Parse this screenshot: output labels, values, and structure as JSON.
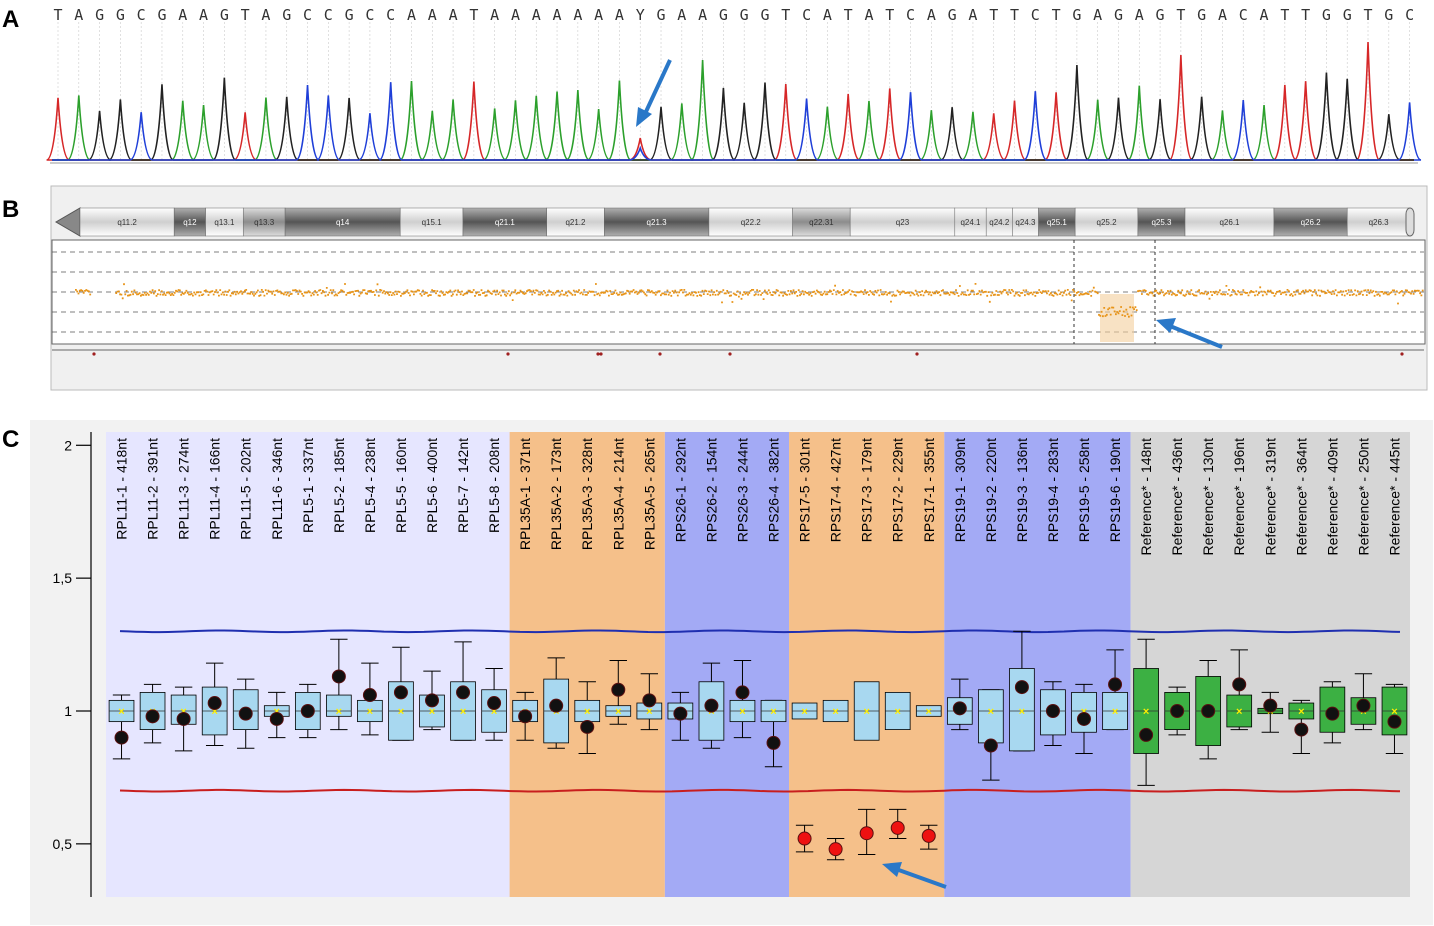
{
  "panels": {
    "a": "A",
    "b": "B",
    "c": "C"
  },
  "sequence": {
    "bases": "TAGGCGAAGTAGCCGCCAAATAAAAAAAYGAAGGGTCATATCAGATTCTGAGAGTGACATTGGTGC",
    "colors": {
      "A": "#2ca02c",
      "T": "#d62728",
      "G": "#222222",
      "C": "#1f3fd8"
    },
    "highlighted_index": 28
  },
  "karyotype": {
    "bands": [
      {
        "label": "q11.2",
        "stain": "light"
      },
      {
        "label": "q12",
        "stain": "dark"
      },
      {
        "label": "q13.1",
        "stain": "light"
      },
      {
        "label": "q13.3",
        "stain": "mid"
      },
      {
        "label": "q14",
        "stain": "dark"
      },
      {
        "label": "q15.1",
        "stain": "light"
      },
      {
        "label": "q21.1",
        "stain": "dark"
      },
      {
        "label": "q21.2",
        "stain": "light"
      },
      {
        "label": "q21.3",
        "stain": "dark"
      },
      {
        "label": "q22.2",
        "stain": "light"
      },
      {
        "label": "q22.31",
        "stain": "mid"
      },
      {
        "label": "q23",
        "stain": "light"
      },
      {
        "label": "q24.1",
        "stain": "light"
      },
      {
        "label": "q24.2",
        "stain": "light"
      },
      {
        "label": "q24.3",
        "stain": "light"
      },
      {
        "label": "q25.1",
        "stain": "dark"
      },
      {
        "label": "q25.2",
        "stain": "light"
      },
      {
        "label": "q25.3",
        "stain": "dark"
      },
      {
        "label": "q26.1",
        "stain": "light"
      },
      {
        "label": "q26.2",
        "stain": "dark"
      },
      {
        "label": "q26.3",
        "stain": "light"
      }
    ],
    "deleted_region": {
      "start_band": "q25.2",
      "end_band": "q25.2"
    }
  },
  "chart_data": {
    "type": "box",
    "ylim": [
      0.3,
      2.05
    ],
    "yticks": [
      {
        "value": 0.5,
        "label": "0,5"
      },
      {
        "value": 1,
        "label": "1"
      },
      {
        "value": 1.5,
        "label": "1,5"
      },
      {
        "value": 2,
        "label": "2"
      }
    ],
    "thresholds": {
      "upper": 1.3,
      "lower": 0.7,
      "upper_color": "#1f2fb0",
      "lower_color": "#c81e1e"
    },
    "groups": [
      {
        "name": "RPL11/RPL5",
        "color": "#e6e6ff",
        "count": 13
      },
      {
        "name": "RPL35A",
        "color": "#f5c08a",
        "count": 5
      },
      {
        "name": "RPS26",
        "color": "#a3aaf5",
        "count": 4
      },
      {
        "name": "RPS17",
        "color": "#f5c08a",
        "count": 5
      },
      {
        "name": "RPS19",
        "color": "#a3aaf5",
        "count": 6
      },
      {
        "name": "Reference",
        "color": "#d6d6d6",
        "count": 9
      }
    ],
    "probes": [
      {
        "label": "RPL11-1 - 418nt",
        "value": 0.9,
        "q1": 0.96,
        "q3": 1.04,
        "min": 0.82,
        "max": 1.06
      },
      {
        "label": "RPL11-2 - 391nt",
        "value": 0.98,
        "q1": 0.93,
        "q3": 1.07,
        "min": 0.88,
        "max": 1.1
      },
      {
        "label": "RPL11-3 - 274nt",
        "value": 0.97,
        "q1": 0.95,
        "q3": 1.06,
        "min": 0.85,
        "max": 1.09
      },
      {
        "label": "RPL11-4 - 166nt",
        "value": 1.03,
        "q1": 0.91,
        "q3": 1.09,
        "min": 0.87,
        "max": 1.18
      },
      {
        "label": "RPL11-5 - 202nt",
        "value": 0.99,
        "q1": 0.93,
        "q3": 1.08,
        "min": 0.86,
        "max": 1.12
      },
      {
        "label": "RPL11-6 - 346nt",
        "value": 0.97,
        "q1": 0.98,
        "q3": 1.02,
        "min": 0.9,
        "max": 1.07
      },
      {
        "label": "RPL5-1 - 337nt",
        "value": 1.0,
        "q1": 0.93,
        "q3": 1.07,
        "min": 0.9,
        "max": 1.1
      },
      {
        "label": "RPL5-2 - 185nt",
        "value": 1.13,
        "q1": 0.98,
        "q3": 1.06,
        "min": 0.93,
        "max": 1.27
      },
      {
        "label": "RPL5-4 - 238nt",
        "value": 1.06,
        "q1": 0.96,
        "q3": 1.04,
        "min": 0.91,
        "max": 1.18
      },
      {
        "label": "RPL5-5 - 160nt",
        "value": 1.07,
        "q1": 0.89,
        "q3": 1.11,
        "min": 0.89,
        "max": 1.24
      },
      {
        "label": "RPL5-6 - 400nt",
        "value": 1.04,
        "q1": 0.94,
        "q3": 1.06,
        "min": 0.93,
        "max": 1.15
      },
      {
        "label": "RPL5-7 - 142nt",
        "value": 1.07,
        "q1": 0.89,
        "q3": 1.11,
        "min": 0.89,
        "max": 1.26
      },
      {
        "label": "RPL5-8 - 208nt",
        "value": 1.03,
        "q1": 0.92,
        "q3": 1.08,
        "min": 0.89,
        "max": 1.16
      },
      {
        "label": "RPL35A-1 - 371nt",
        "value": 0.98,
        "q1": 0.96,
        "q3": 1.04,
        "min": 0.89,
        "max": 1.07
      },
      {
        "label": "RPL35A-2 - 173nt",
        "value": 1.02,
        "q1": 0.88,
        "q3": 1.12,
        "min": 0.86,
        "max": 1.2
      },
      {
        "label": "RPL35A-3 - 328nt",
        "value": 0.94,
        "q1": 0.96,
        "q3": 1.04,
        "min": 0.84,
        "max": 1.11
      },
      {
        "label": "RPL35A-4 - 214nt",
        "value": 1.08,
        "q1": 0.98,
        "q3": 1.02,
        "min": 0.95,
        "max": 1.19
      },
      {
        "label": "RPL35A-5 - 265nt",
        "value": 1.04,
        "q1": 0.97,
        "q3": 1.03,
        "min": 0.93,
        "max": 1.14
      },
      {
        "label": "RPS26-1 - 292nt",
        "value": 0.99,
        "q1": 0.97,
        "q3": 1.03,
        "min": 0.89,
        "max": 1.07
      },
      {
        "label": "RPS26-2 - 154nt",
        "value": 1.02,
        "q1": 0.89,
        "q3": 1.11,
        "min": 0.86,
        "max": 1.18
      },
      {
        "label": "RPS26-3 - 244nt",
        "value": 1.07,
        "q1": 0.96,
        "q3": 1.04,
        "min": 0.9,
        "max": 1.19
      },
      {
        "label": "RPS26-4 - 382nt",
        "value": 0.88,
        "q1": 0.96,
        "q3": 1.04,
        "min": 0.79,
        "max": 1.04
      },
      {
        "label": "RPS17-5 - 301nt",
        "value": 0.52,
        "q1": 0.97,
        "q3": 1.03,
        "min": 0.47,
        "max": 0.57
      },
      {
        "label": "RPS17-4 - 427nt",
        "value": 0.48,
        "q1": 0.96,
        "q3": 1.04,
        "min": 0.44,
        "max": 0.52
      },
      {
        "label": "RPS17-3 - 179nt",
        "value": 0.54,
        "q1": 0.89,
        "q3": 1.11,
        "min": 0.46,
        "max": 0.63
      },
      {
        "label": "RPS17-2 - 229nt",
        "value": 0.56,
        "q1": 0.93,
        "q3": 1.07,
        "min": 0.52,
        "max": 0.63
      },
      {
        "label": "RPS17-1 - 355nt",
        "value": 0.53,
        "q1": 0.98,
        "q3": 1.02,
        "min": 0.48,
        "max": 0.57
      },
      {
        "label": "RPS19-1 - 309nt",
        "value": 1.01,
        "q1": 0.95,
        "q3": 1.05,
        "min": 0.93,
        "max": 1.12
      },
      {
        "label": "RPS19-2 - 220nt",
        "value": 0.87,
        "q1": 0.88,
        "q3": 1.08,
        "min": 0.74,
        "max": 1.08
      },
      {
        "label": "RPS19-3 - 136nt",
        "value": 1.09,
        "q1": 0.85,
        "q3": 1.16,
        "min": 0.85,
        "max": 1.3
      },
      {
        "label": "RPS19-4 - 283nt",
        "value": 1.0,
        "q1": 0.91,
        "q3": 1.08,
        "min": 0.87,
        "max": 1.11
      },
      {
        "label": "RPS19-5 - 258nt",
        "value": 0.97,
        "q1": 0.92,
        "q3": 1.07,
        "min": 0.84,
        "max": 1.1
      },
      {
        "label": "RPS19-6 - 190nt",
        "value": 1.1,
        "q1": 0.93,
        "q3": 1.07,
        "min": 0.93,
        "max": 1.23
      },
      {
        "label": "Reference* - 148nt",
        "value": 0.91,
        "q1": 0.84,
        "q3": 1.16,
        "min": 0.72,
        "max": 1.27
      },
      {
        "label": "Reference* - 436nt",
        "value": 1.0,
        "q1": 0.93,
        "q3": 1.07,
        "min": 0.91,
        "max": 1.09
      },
      {
        "label": "Reference* - 130nt",
        "value": 1.0,
        "q1": 0.87,
        "q3": 1.13,
        "min": 0.82,
        "max": 1.19
      },
      {
        "label": "Reference* - 196nt",
        "value": 1.1,
        "q1": 0.94,
        "q3": 1.06,
        "min": 0.93,
        "max": 1.23
      },
      {
        "label": "Reference* - 319nt",
        "value": 1.02,
        "q1": 0.99,
        "q3": 1.01,
        "min": 0.92,
        "max": 1.07
      },
      {
        "label": "Reference* - 364nt",
        "value": 0.93,
        "q1": 0.97,
        "q3": 1.03,
        "min": 0.84,
        "max": 1.04
      },
      {
        "label": "Reference* - 409nt",
        "value": 0.99,
        "q1": 0.92,
        "q3": 1.09,
        "min": 0.88,
        "max": 1.11
      },
      {
        "label": "Reference* - 250nt",
        "value": 1.02,
        "q1": 0.95,
        "q3": 1.05,
        "min": 0.93,
        "max": 1.14
      },
      {
        "label": "Reference* - 445nt",
        "value": 0.96,
        "q1": 0.91,
        "q3": 1.09,
        "min": 0.84,
        "max": 1.1
      }
    ]
  }
}
